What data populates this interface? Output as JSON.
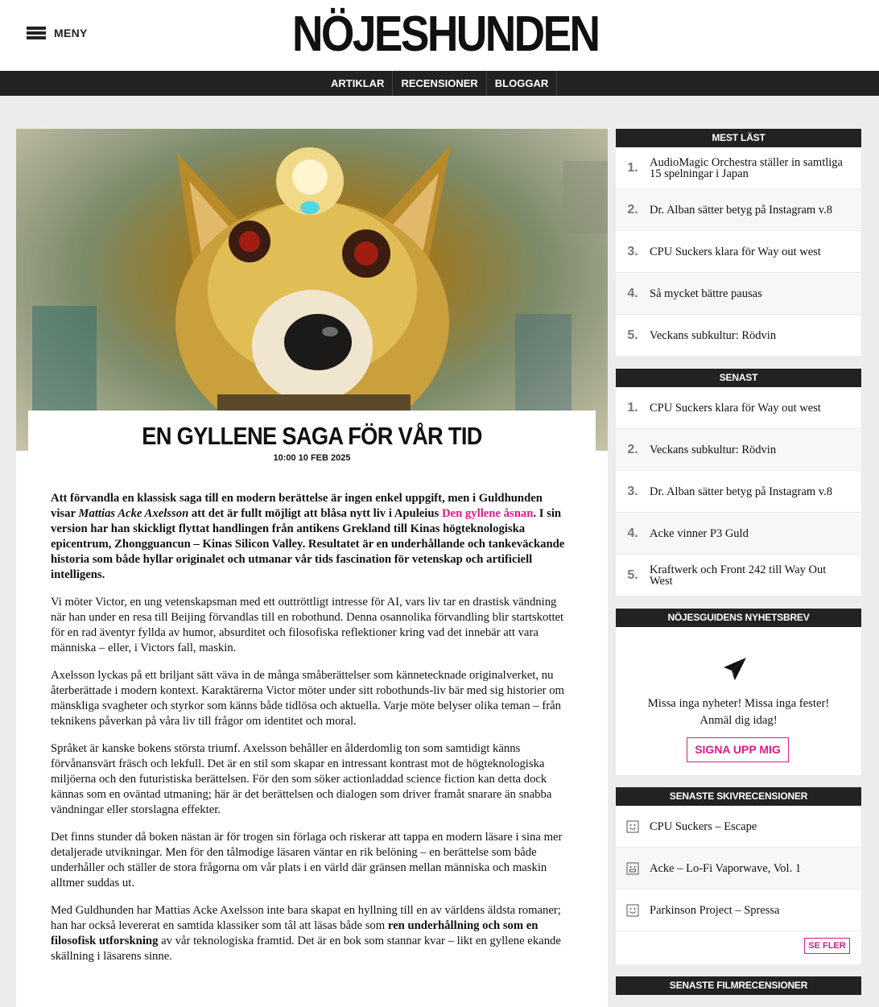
{
  "header": {
    "menu_label": "MENY",
    "logo": "NÖJESHUNDEN"
  },
  "nav": {
    "items": [
      "ARTIKLAR",
      "RECENSIONER",
      "BLOGGAR"
    ]
  },
  "article": {
    "title": "EN GYLLENE SAGA FÖR VÅR TID",
    "date": "10:00 10 FEB 2025",
    "lead": {
      "part1": "Att förvandla en klassisk saga till en modern berättelse är ingen enkel uppgift, men i Guldhunden visar ",
      "author": "Mattias Acke Axelsson",
      "part2": " att det är fullt möjligt att blåsa nytt liv i Apuleius ",
      "link": "Den gyllene åsnan",
      "part3": ". I sin version har han skickligt flyttat handlingen från antikens Grekland till Kinas högteknologiska epicentrum, Zhongguancun – Kinas Silicon Valley. Resultatet är en underhållande och tankeväckande historia som både hyllar originalet och utmanar vår tids fascination för vetenskap och artificiell intelligens."
    },
    "paragraphs": [
      "Vi möter Victor, en ung vetenskapsman med ett outtröttligt intresse för AI, vars liv tar en drastisk vändning när han under en resa till Beijing förvandlas till en robothund. Denna osannolika förvandling blir startskottet för en rad äventyr fyllda av humor, absurditet och filosofiska reflektioner kring vad det innebär att vara människa – eller, i Victors fall, maskin.",
      "Axelsson lyckas på ett briljant sätt väva in de många småberättelser som kännetecknade originalverket, nu återberättade i modern kontext. Karaktärerna Victor möter under sitt robothunds-liv bär med sig historier om mänskliga svagheter och styrkor som känns både tidlösa och aktuella. Varje möte belyser olika teman – från teknikens påverkan på våra liv till frågor om identitet och moral.",
      "Språket är kanske bokens största triumf. Axelsson behåller en ålderdomlig ton som samtidigt känns förvånansvärt fräsch och lekfull. Det är en stil som skapar en intressant kontrast mot de högteknologiska miljöerna och den futuristiska berättelsen. För den som söker actionladdad science fiction kan detta dock kännas som en oväntad utmaning; här är det berättelsen och dialogen som driver framåt snarare än snabba vändningar eller storslagna effekter.",
      "Det finns stunder då boken nästan är för trogen sin förlaga och riskerar att tappa en modern läsare i sina mer detaljerade utvikningar. Men för den tålmodige läsaren väntar en rik belöning – en berättelse som både underhåller och ställer de stora frågorna om vår plats i en värld där gränsen mellan människa och maskin alltmer suddas ut."
    ],
    "final": {
      "part1": "Med Guldhunden har Mattias Acke Axelsson inte bara skapat en hyllning till en av världens äldsta romaner; han har också levererat en samtida klassiker som tål att läsas både som ",
      "bold": "ren underhållning och som en filosofisk utforskning",
      "part2": " av vår teknologiska framtid. Det är en bok som stannar kvar – likt en gyllene ekande skällning i läsarens sinne."
    }
  },
  "sidebar": {
    "most_read": {
      "title": "MEST LÄST",
      "items": [
        {
          "num": "1.",
          "text": "AudioMagic Orchestra ställer in samtliga 15 spelningar i Japan"
        },
        {
          "num": "2.",
          "text": "Dr. Alban sätter betyg på Instagram v.8"
        },
        {
          "num": "3.",
          "text": "CPU Suckers klara för Way out west"
        },
        {
          "num": "4.",
          "text": "Så mycket bättre pausas"
        },
        {
          "num": "5.",
          "text": "Veckans subkultur: Rödvin"
        }
      ]
    },
    "latest": {
      "title": "SENAST",
      "items": [
        {
          "num": "1.",
          "text": "CPU Suckers klara för Way out west"
        },
        {
          "num": "2.",
          "text": "Veckans subkultur: Rödvin"
        },
        {
          "num": "3.",
          "text": "Dr. Alban sätter betyg på Instagram v.8"
        },
        {
          "num": "4.",
          "text": "Acke vinner P3 Guld"
        },
        {
          "num": "5.",
          "text": "Kraftwerk och Front 242 till Way Out West"
        }
      ]
    },
    "newsletter": {
      "title": "NÖJESGUIDENS NYHETSBREV",
      "line1": "Missa inga nyheter! Missa inga fester!",
      "line2": "Anmäl dig idag!",
      "button": "SIGNA UPP MIG",
      "icon": "paper-plane-icon"
    },
    "record_reviews": {
      "title": "SENASTE SKIVRECENSIONER",
      "items": [
        {
          "text": "CPU Suckers – Escape",
          "icon": "smiley-icon"
        },
        {
          "text": "Acke – Lo-Fi Vaporwave, Vol. 1",
          "icon": "grin-icon"
        },
        {
          "text": "Parkinson Project – Spressa",
          "icon": "smiley-icon"
        }
      ],
      "see_more": "SE FLER"
    },
    "film_reviews": {
      "title": "SENASTE FILMRECENSIONER"
    }
  },
  "colors": {
    "accent": "#e0188a",
    "dark": "#222222",
    "background": "#ececec"
  }
}
